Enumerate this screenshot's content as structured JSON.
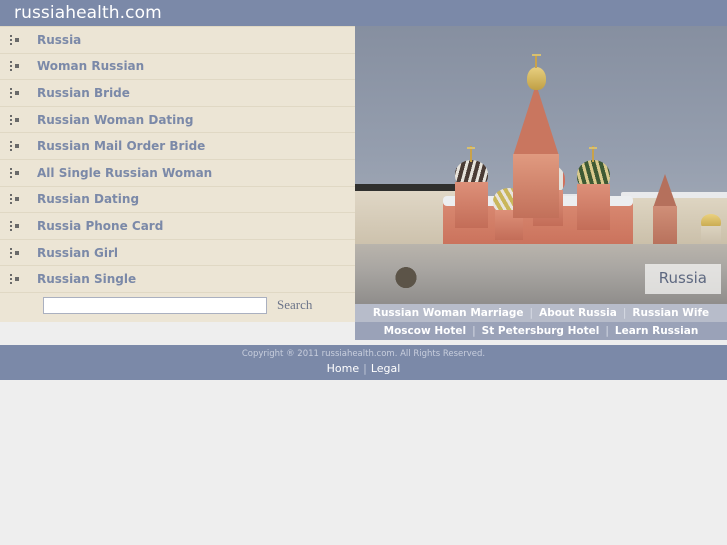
{
  "header": {
    "site_title": "russiahealth.com",
    "background_color": "#7b89a8",
    "title_color": "#ffffff"
  },
  "sidebar": {
    "background_color": "#ece5d5",
    "link_color": "#7b89a8",
    "bullet_icon": "bullet-square-icon",
    "items": [
      {
        "label": "Russia"
      },
      {
        "label": "Woman Russian"
      },
      {
        "label": "Russian Bride"
      },
      {
        "label": "Russian Woman Dating"
      },
      {
        "label": "Russian Mail Order Bride"
      },
      {
        "label": "All Single Russian Woman"
      },
      {
        "label": "Russian Dating"
      },
      {
        "label": "Russia Phone Card"
      },
      {
        "label": "Russian Girl"
      },
      {
        "label": "Russian Single"
      }
    ]
  },
  "search": {
    "value": "",
    "placeholder": "",
    "button_label": "Search"
  },
  "hero": {
    "caption": "Russia",
    "alt": "Saint Basil's Cathedral on Red Square in winter snow, Moscow"
  },
  "nav_rows": [
    {
      "background_color": "#b7bcca",
      "links": [
        {
          "label": "Russian Woman Marriage"
        },
        {
          "label": "About Russia"
        },
        {
          "label": "Russian Wife"
        }
      ],
      "separator": "|"
    },
    {
      "background_color": "#9aa2b8",
      "links": [
        {
          "label": "Moscow Hotel"
        },
        {
          "label": "St Petersburg Hotel"
        },
        {
          "label": "Learn Russian"
        }
      ],
      "separator": "|"
    }
  ],
  "footer": {
    "background_color": "#7b89a8",
    "copyright": "Copyright ® 2011 russiahealth.com. All Rights Reserved.",
    "links": [
      {
        "label": "Home"
      },
      {
        "label": "Legal"
      }
    ],
    "separator": "|"
  }
}
